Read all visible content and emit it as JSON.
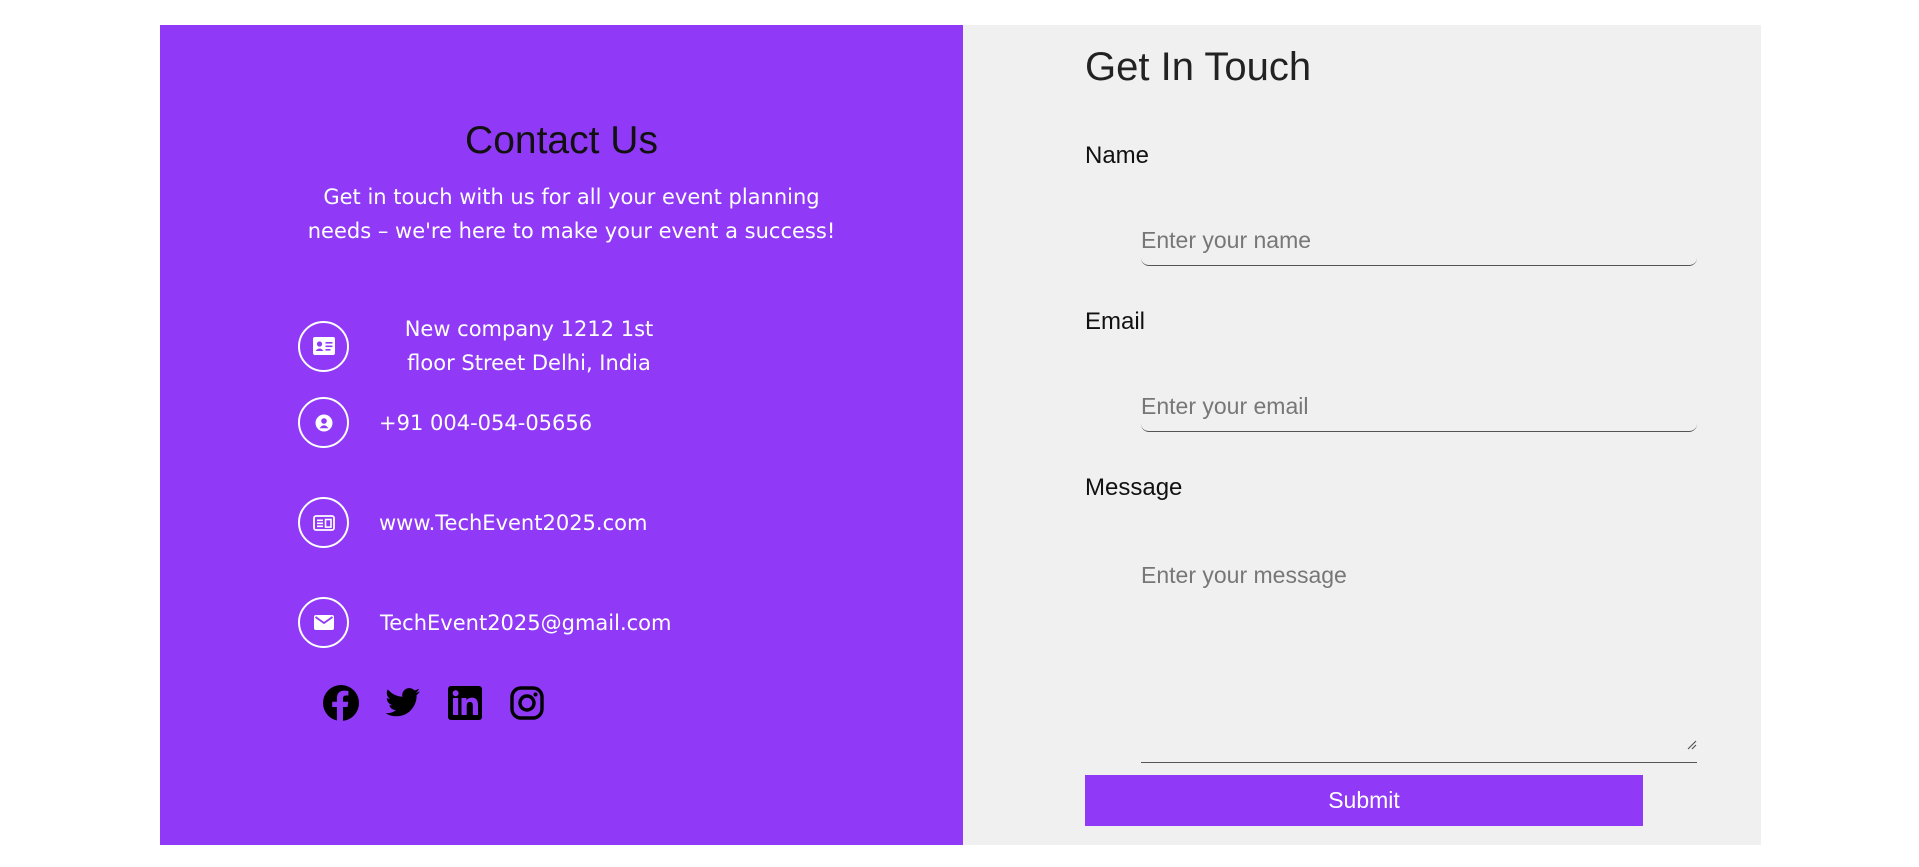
{
  "colors": {
    "accent": "#9039f7",
    "panel_bg": "#f0f0f0",
    "text_light": "#ffffff"
  },
  "contact": {
    "title": "Contact Us",
    "subtitle": "Get in touch with us for all your event planning needs – we're here to make your event a success!",
    "address": {
      "icon": "id-card-icon",
      "text": "New company 1212 1st floor Street Delhi, India"
    },
    "phone": {
      "icon": "user-icon",
      "text": "+91 004-054-05656"
    },
    "website": {
      "icon": "web-card-icon",
      "text": "www.TechEvent2025.com"
    },
    "email": {
      "icon": "envelope-icon",
      "text": "TechEvent2025@gmail.com"
    },
    "socials": [
      "facebook-icon",
      "twitter-icon",
      "linkedin-icon",
      "instagram-icon"
    ]
  },
  "form": {
    "title": "Get In Touch",
    "name_label": "Name",
    "name_placeholder": "Enter your name",
    "name_value": "",
    "email_label": "Email",
    "email_placeholder": "Enter your email",
    "email_value": "",
    "message_label": "Message",
    "message_placeholder": "Enter your message",
    "message_value": "",
    "submit_label": "Submit"
  }
}
